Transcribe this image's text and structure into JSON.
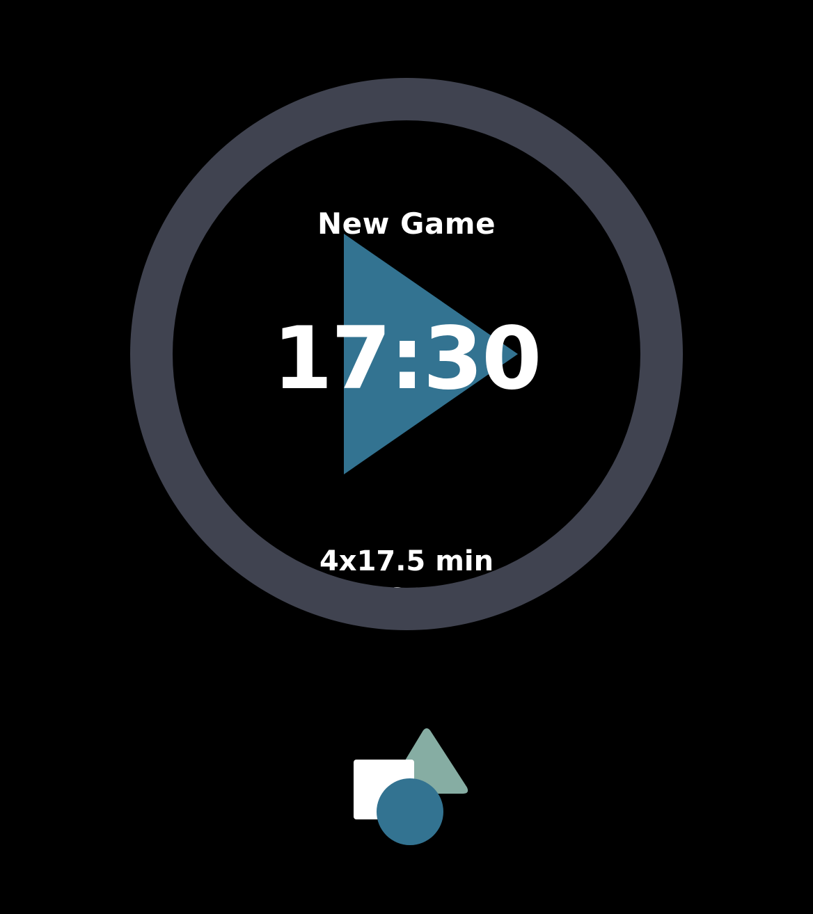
{
  "game": {
    "title": "New Game",
    "clock": "17:30",
    "format": "4x17.5 min",
    "period": "Q1"
  },
  "icons": {
    "play": "play-icon",
    "logo": "shapes-icon"
  },
  "colors": {
    "background": "#000000",
    "ring": "#404350",
    "play": "#337391",
    "square": "#ffffff",
    "triangle": "#86ada3",
    "circle": "#337391",
    "text": "#ffffff"
  }
}
